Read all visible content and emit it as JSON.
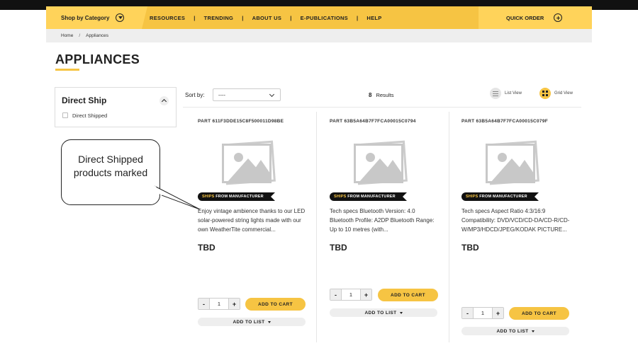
{
  "nav": {
    "shop_by_category": "Shop by Category",
    "links": [
      "RESOURCES",
      "TRENDING",
      "ABOUT US",
      "E-PUBLICATIONS",
      "HELP"
    ],
    "separator": "|",
    "quick_order": "QUICK ORDER"
  },
  "breadcrumb": {
    "home": "Home",
    "separator": "/",
    "current": "Appliances"
  },
  "page": {
    "title": "APPLIANCES"
  },
  "filter": {
    "title": "Direct Ship",
    "option": "Direct Shipped"
  },
  "toolbar": {
    "sort_label": "Sort by:",
    "sort_value": "----",
    "results_count": "8",
    "results_label": "Results",
    "list_view": "List View",
    "grid_view": "Grid View"
  },
  "badge": {
    "ships": "SHIPS",
    "from_manufacturer": "FROM MANUFACTURER"
  },
  "buttons": {
    "add_to_cart": "ADD TO CART",
    "add_to_list": "ADD TO LIST",
    "minus": "-",
    "plus": "+"
  },
  "products": [
    {
      "part": "PART 611F3DDE15C8F500011D98BE",
      "description": "Enjoy vintage ambience thanks to our LED solar-powered string lights made with our own WeatherTite commercial...",
      "price": "TBD",
      "qty": "1"
    },
    {
      "part": "PART 63B5A64B7F7FCA00015C0794",
      "description": "Tech specs Bluetooth Version: 4.0 Bluetooth Profile: A2DP Bluetooth Range: Up to 10 metres (with...",
      "price": "TBD",
      "qty": "1"
    },
    {
      "part": "PART 63B5A64B7F7FCA00015C079F",
      "description": "Tech specs Aspect Ratio 4:3/16:9 Compatibility: DVD/VCD/CD-DA/CD-R/CD-W/MP3/HDCD/JPEG/KODAK PICTURE...",
      "price": "TBD",
      "qty": "1"
    }
  ],
  "callout": {
    "text": "Direct Shipped products marked"
  },
  "icons": {
    "category": "chevron-down-circle-icon",
    "quick_order": "plus-circle-icon",
    "image": "image-placeholder-icon"
  },
  "colors": {
    "accent": "#f6c443",
    "accent_light": "#ffd35a",
    "topbar": "#111111"
  }
}
